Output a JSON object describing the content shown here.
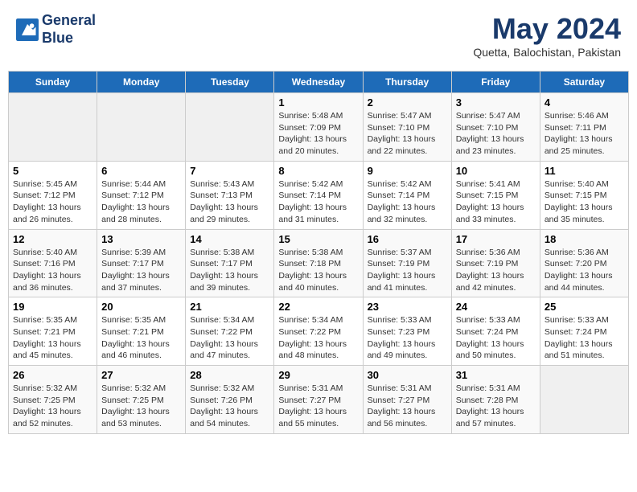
{
  "header": {
    "logo_line1": "General",
    "logo_line2": "Blue",
    "month": "May 2024",
    "location": "Quetta, Balochistan, Pakistan"
  },
  "days_of_week": [
    "Sunday",
    "Monday",
    "Tuesday",
    "Wednesday",
    "Thursday",
    "Friday",
    "Saturday"
  ],
  "weeks": [
    [
      {
        "day": "",
        "info": ""
      },
      {
        "day": "",
        "info": ""
      },
      {
        "day": "",
        "info": ""
      },
      {
        "day": "1",
        "info": "Sunrise: 5:48 AM\nSunset: 7:09 PM\nDaylight: 13 hours and 20 minutes."
      },
      {
        "day": "2",
        "info": "Sunrise: 5:47 AM\nSunset: 7:10 PM\nDaylight: 13 hours and 22 minutes."
      },
      {
        "day": "3",
        "info": "Sunrise: 5:47 AM\nSunset: 7:10 PM\nDaylight: 13 hours and 23 minutes."
      },
      {
        "day": "4",
        "info": "Sunrise: 5:46 AM\nSunset: 7:11 PM\nDaylight: 13 hours and 25 minutes."
      }
    ],
    [
      {
        "day": "5",
        "info": "Sunrise: 5:45 AM\nSunset: 7:12 PM\nDaylight: 13 hours and 26 minutes."
      },
      {
        "day": "6",
        "info": "Sunrise: 5:44 AM\nSunset: 7:12 PM\nDaylight: 13 hours and 28 minutes."
      },
      {
        "day": "7",
        "info": "Sunrise: 5:43 AM\nSunset: 7:13 PM\nDaylight: 13 hours and 29 minutes."
      },
      {
        "day": "8",
        "info": "Sunrise: 5:42 AM\nSunset: 7:14 PM\nDaylight: 13 hours and 31 minutes."
      },
      {
        "day": "9",
        "info": "Sunrise: 5:42 AM\nSunset: 7:14 PM\nDaylight: 13 hours and 32 minutes."
      },
      {
        "day": "10",
        "info": "Sunrise: 5:41 AM\nSunset: 7:15 PM\nDaylight: 13 hours and 33 minutes."
      },
      {
        "day": "11",
        "info": "Sunrise: 5:40 AM\nSunset: 7:15 PM\nDaylight: 13 hours and 35 minutes."
      }
    ],
    [
      {
        "day": "12",
        "info": "Sunrise: 5:40 AM\nSunset: 7:16 PM\nDaylight: 13 hours and 36 minutes."
      },
      {
        "day": "13",
        "info": "Sunrise: 5:39 AM\nSunset: 7:17 PM\nDaylight: 13 hours and 37 minutes."
      },
      {
        "day": "14",
        "info": "Sunrise: 5:38 AM\nSunset: 7:17 PM\nDaylight: 13 hours and 39 minutes."
      },
      {
        "day": "15",
        "info": "Sunrise: 5:38 AM\nSunset: 7:18 PM\nDaylight: 13 hours and 40 minutes."
      },
      {
        "day": "16",
        "info": "Sunrise: 5:37 AM\nSunset: 7:19 PM\nDaylight: 13 hours and 41 minutes."
      },
      {
        "day": "17",
        "info": "Sunrise: 5:36 AM\nSunset: 7:19 PM\nDaylight: 13 hours and 42 minutes."
      },
      {
        "day": "18",
        "info": "Sunrise: 5:36 AM\nSunset: 7:20 PM\nDaylight: 13 hours and 44 minutes."
      }
    ],
    [
      {
        "day": "19",
        "info": "Sunrise: 5:35 AM\nSunset: 7:21 PM\nDaylight: 13 hours and 45 minutes."
      },
      {
        "day": "20",
        "info": "Sunrise: 5:35 AM\nSunset: 7:21 PM\nDaylight: 13 hours and 46 minutes."
      },
      {
        "day": "21",
        "info": "Sunrise: 5:34 AM\nSunset: 7:22 PM\nDaylight: 13 hours and 47 minutes."
      },
      {
        "day": "22",
        "info": "Sunrise: 5:34 AM\nSunset: 7:22 PM\nDaylight: 13 hours and 48 minutes."
      },
      {
        "day": "23",
        "info": "Sunrise: 5:33 AM\nSunset: 7:23 PM\nDaylight: 13 hours and 49 minutes."
      },
      {
        "day": "24",
        "info": "Sunrise: 5:33 AM\nSunset: 7:24 PM\nDaylight: 13 hours and 50 minutes."
      },
      {
        "day": "25",
        "info": "Sunrise: 5:33 AM\nSunset: 7:24 PM\nDaylight: 13 hours and 51 minutes."
      }
    ],
    [
      {
        "day": "26",
        "info": "Sunrise: 5:32 AM\nSunset: 7:25 PM\nDaylight: 13 hours and 52 minutes."
      },
      {
        "day": "27",
        "info": "Sunrise: 5:32 AM\nSunset: 7:25 PM\nDaylight: 13 hours and 53 minutes."
      },
      {
        "day": "28",
        "info": "Sunrise: 5:32 AM\nSunset: 7:26 PM\nDaylight: 13 hours and 54 minutes."
      },
      {
        "day": "29",
        "info": "Sunrise: 5:31 AM\nSunset: 7:27 PM\nDaylight: 13 hours and 55 minutes."
      },
      {
        "day": "30",
        "info": "Sunrise: 5:31 AM\nSunset: 7:27 PM\nDaylight: 13 hours and 56 minutes."
      },
      {
        "day": "31",
        "info": "Sunrise: 5:31 AM\nSunset: 7:28 PM\nDaylight: 13 hours and 57 minutes."
      },
      {
        "day": "",
        "info": ""
      }
    ]
  ]
}
